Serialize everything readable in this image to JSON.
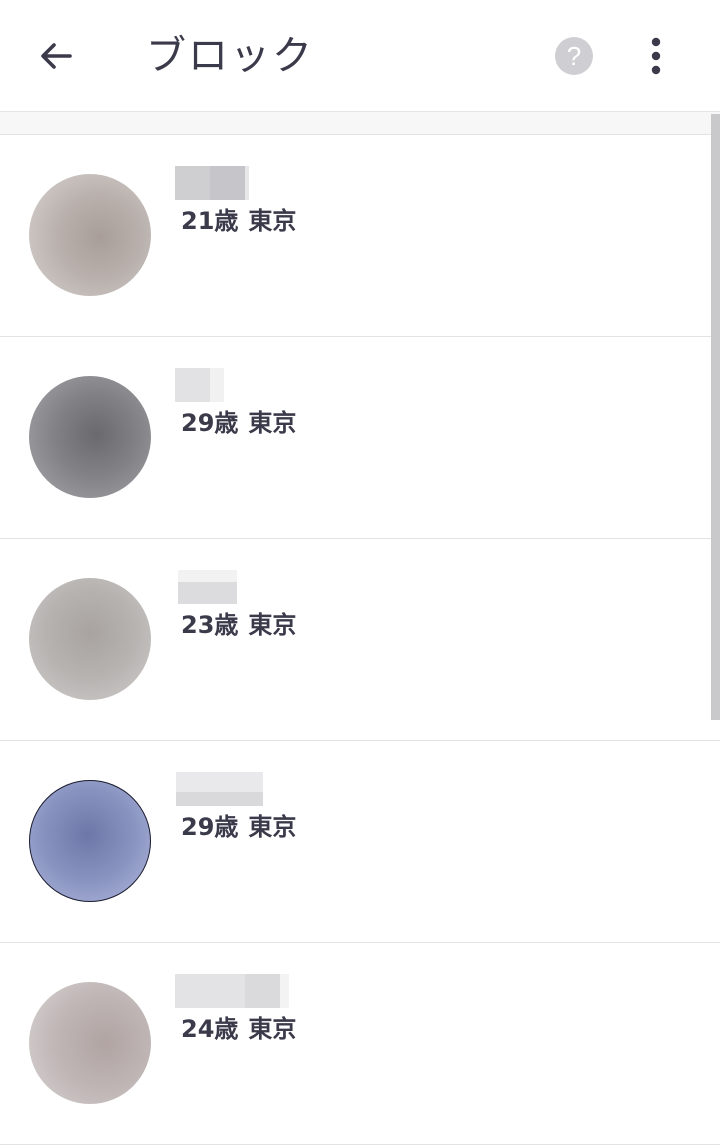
{
  "header": {
    "title": "ブロック",
    "back_icon": "arrow-left-icon",
    "help_icon": "question-circle-icon",
    "help_glyph": "?",
    "more_icon": "more-vertical-icon"
  },
  "colors": {
    "text": "#3b3a4a",
    "divider": "#e3e3e6",
    "help_circle": "#cfced3"
  },
  "users": [
    {
      "age": "21歳",
      "location": "東京"
    },
    {
      "age": "29歳",
      "location": "東京"
    },
    {
      "age": "23歳",
      "location": "東京"
    },
    {
      "age": "29歳",
      "location": "東京"
    },
    {
      "age": "24歳",
      "location": "東京"
    }
  ]
}
